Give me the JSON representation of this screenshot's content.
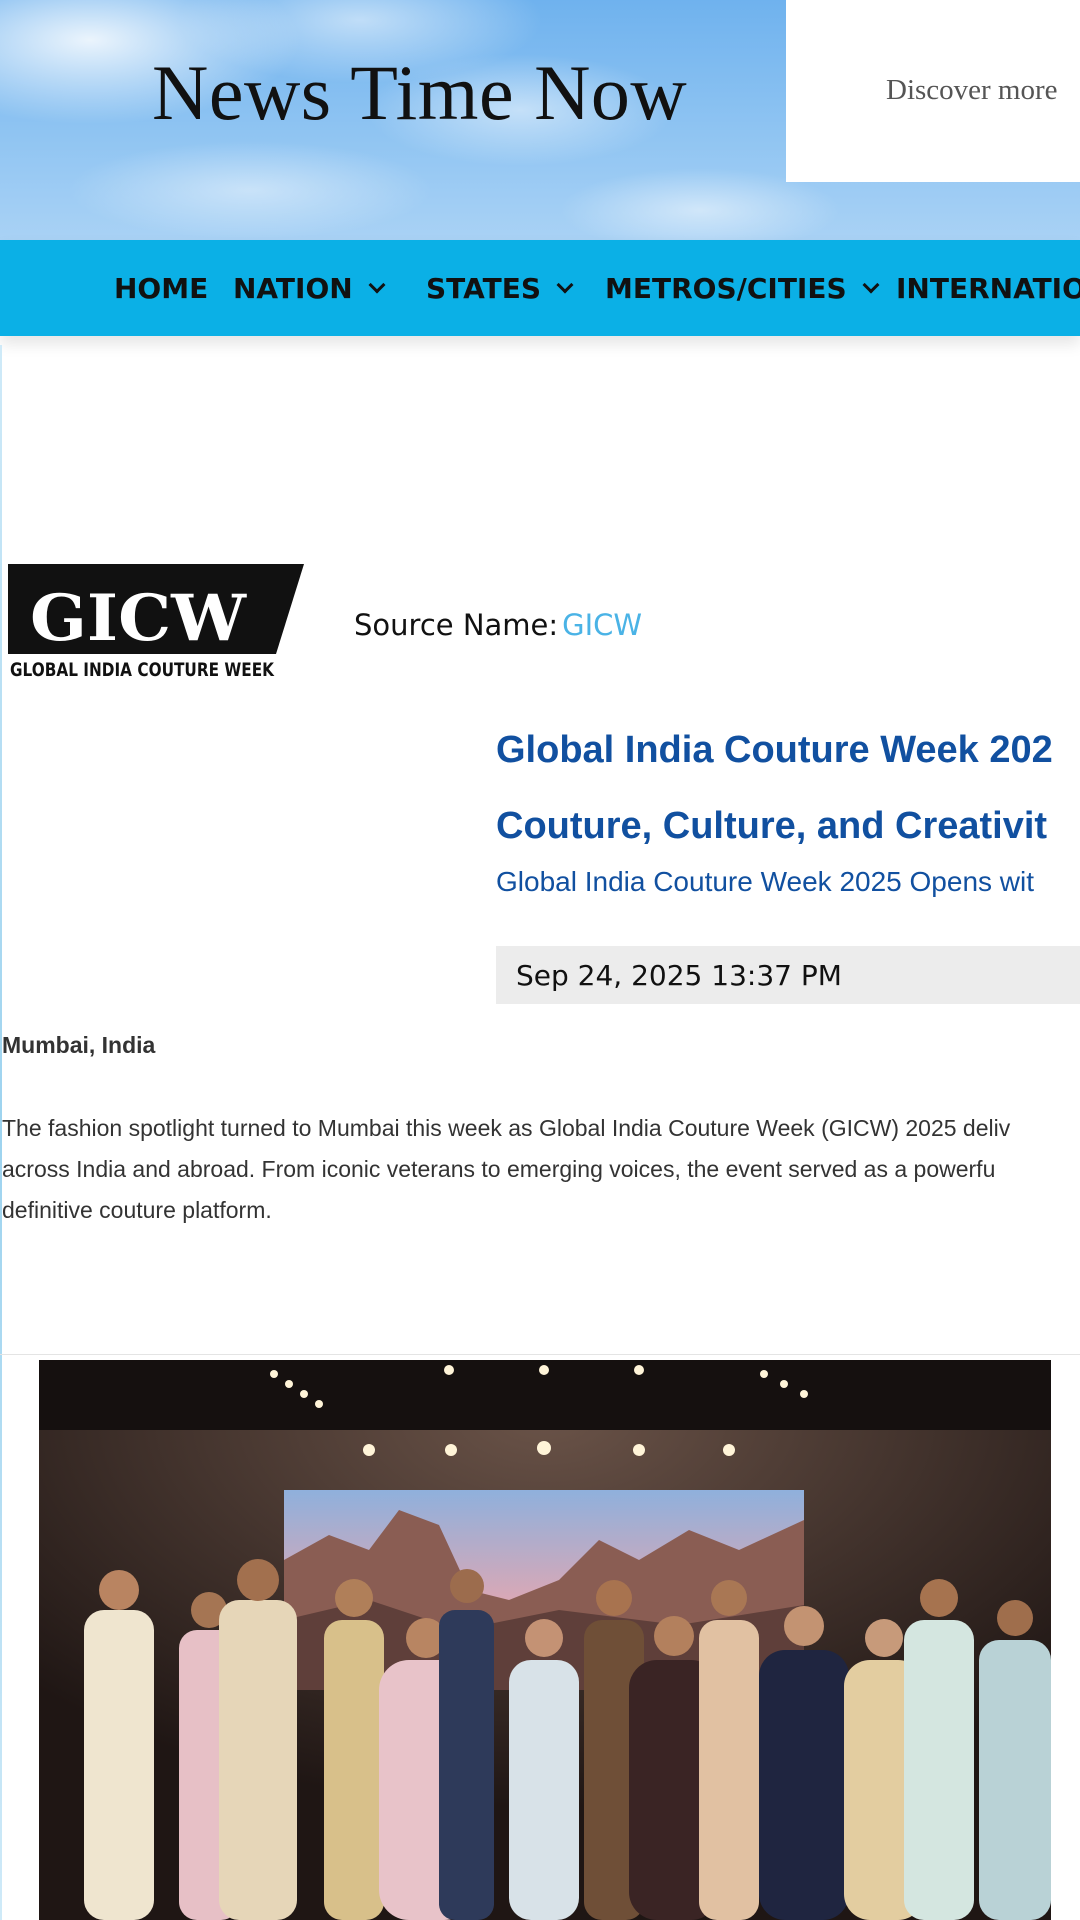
{
  "header": {
    "site_title": "News Time Now",
    "discover_text": "Discover more"
  },
  "nav": {
    "items": [
      {
        "label": "HOME",
        "has_dropdown": false
      },
      {
        "label": "NATION",
        "has_dropdown": true
      },
      {
        "label": "STATES",
        "has_dropdown": true
      },
      {
        "label": "METROS/CITIES",
        "has_dropdown": true
      },
      {
        "label": "INTERNATION",
        "has_dropdown": false
      }
    ],
    "background_color": "#0bb0e6"
  },
  "source": {
    "logo_main_text": "GICW",
    "logo_sub_text": "GLOBAL INDIA COUTURE WEEK",
    "label": "Source Name:",
    "name": "GICW"
  },
  "article": {
    "headline_line1": "Global India Couture Week 202",
    "headline_line2": "Couture, Culture, and Creativit",
    "subheadline": "Global India Couture Week 2025 Opens wit",
    "date": "Sep 24, 2025 13:37 PM",
    "dateline": "Mumbai, India",
    "body_lines": [
      "The fashion spotlight turned to Mumbai this week as Global India Couture Week (GICW) 2025 deliv",
      "across India and abroad. From iconic veterans to emerging voices, the event served as a powerfu",
      "definitive couture platform."
    ],
    "headline_color": "#1150a0",
    "link_color": "#4ab3e6"
  }
}
